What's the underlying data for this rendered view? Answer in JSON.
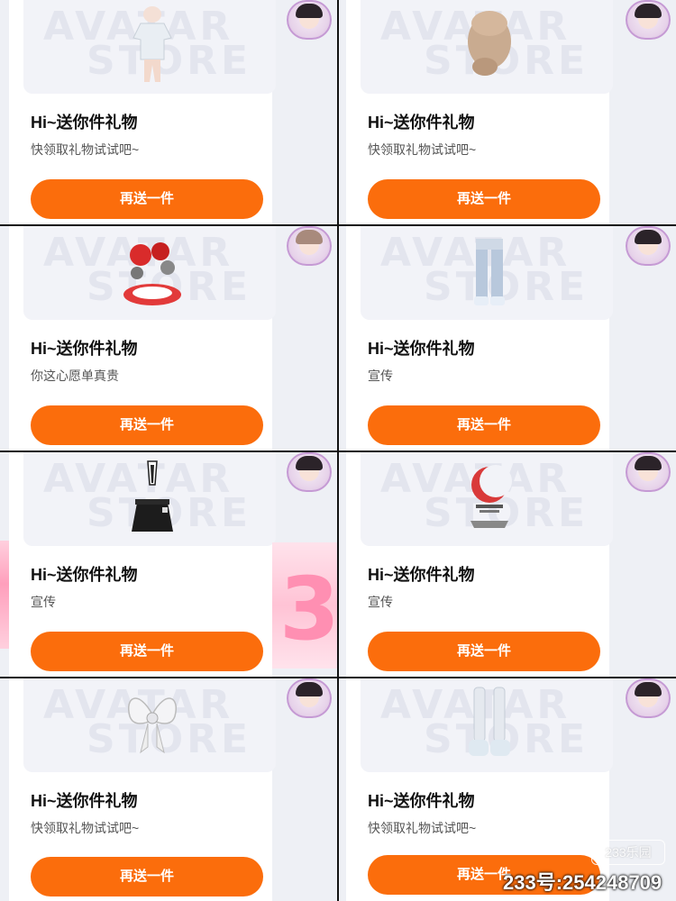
{
  "cards": [
    {
      "title": "Hi~送你件礼物",
      "subtitle": "快领取礼物试试吧~",
      "button": "再送一件",
      "item_icon": "outfit-top-icon"
    },
    {
      "title": "Hi~送你件礼物",
      "subtitle": "快领取礼物试试吧~",
      "button": "再送一件",
      "item_icon": "hair-bun-icon"
    },
    {
      "title": "Hi~送你件礼物",
      "subtitle": "你这心愿单真贵",
      "button": "再送一件",
      "item_icon": "red-prop-icon"
    },
    {
      "title": "Hi~送你件礼物",
      "subtitle": "宣传",
      "button": "再送一件",
      "item_icon": "jeans-icon"
    },
    {
      "title": "Hi~送你件礼物",
      "subtitle": "宣传",
      "button": "再送一件",
      "item_icon": "skirt-icon"
    },
    {
      "title": "Hi~送你件礼物",
      "subtitle": "宣传",
      "button": "再送一件",
      "item_icon": "moon-prop-icon"
    },
    {
      "title": "Hi~送你件礼物",
      "subtitle": "快领取礼物试试吧~",
      "button": "再送一件",
      "item_icon": "bow-icon"
    },
    {
      "title": "Hi~送你件礼物",
      "subtitle": "快领取礼物试试吧~",
      "button": "再送一件",
      "item_icon": "boots-icon"
    }
  ],
  "thumbnail_watermark": [
    "AVATAR",
    "STORE"
  ],
  "decoration_text": "3",
  "watermark": {
    "logo": "233乐园",
    "id": "233号:254248709"
  },
  "colors": {
    "button": "#fb6d0c",
    "card": "#ffffff",
    "thumb_bg": "#f2f3f8",
    "side_bg": "#eef0f5",
    "divider": "#121212"
  }
}
